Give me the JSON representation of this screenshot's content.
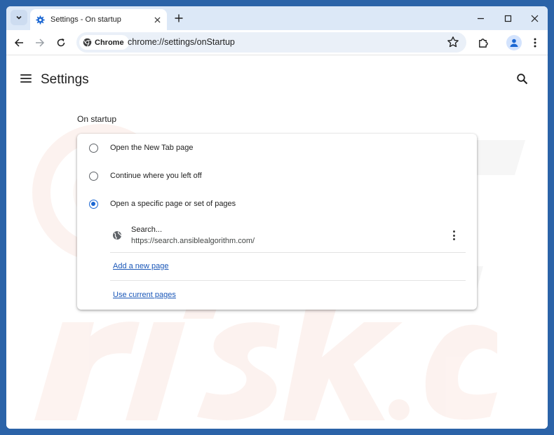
{
  "browser": {
    "tab": {
      "title": "Settings - On startup"
    },
    "omnibox": {
      "chip_label": "Chrome",
      "url": "chrome://settings/onStartup"
    }
  },
  "settings": {
    "title": "Settings",
    "section_title": "On startup",
    "options": [
      {
        "label": "Open the New Tab page",
        "selected": false
      },
      {
        "label": "Continue where you left off",
        "selected": false
      },
      {
        "label": "Open a specific page or set of pages",
        "selected": true
      }
    ],
    "startup_page": {
      "title": "Search...",
      "url": "https://search.ansiblealgorithm.com/"
    },
    "add_page_link": "Add a new page",
    "use_current_link": "Use current pages"
  },
  "colors": {
    "accent": "#1a66d2",
    "link": "#1a57b8",
    "titlebar": "#dce8f7",
    "desktop": "#2b63a8"
  }
}
